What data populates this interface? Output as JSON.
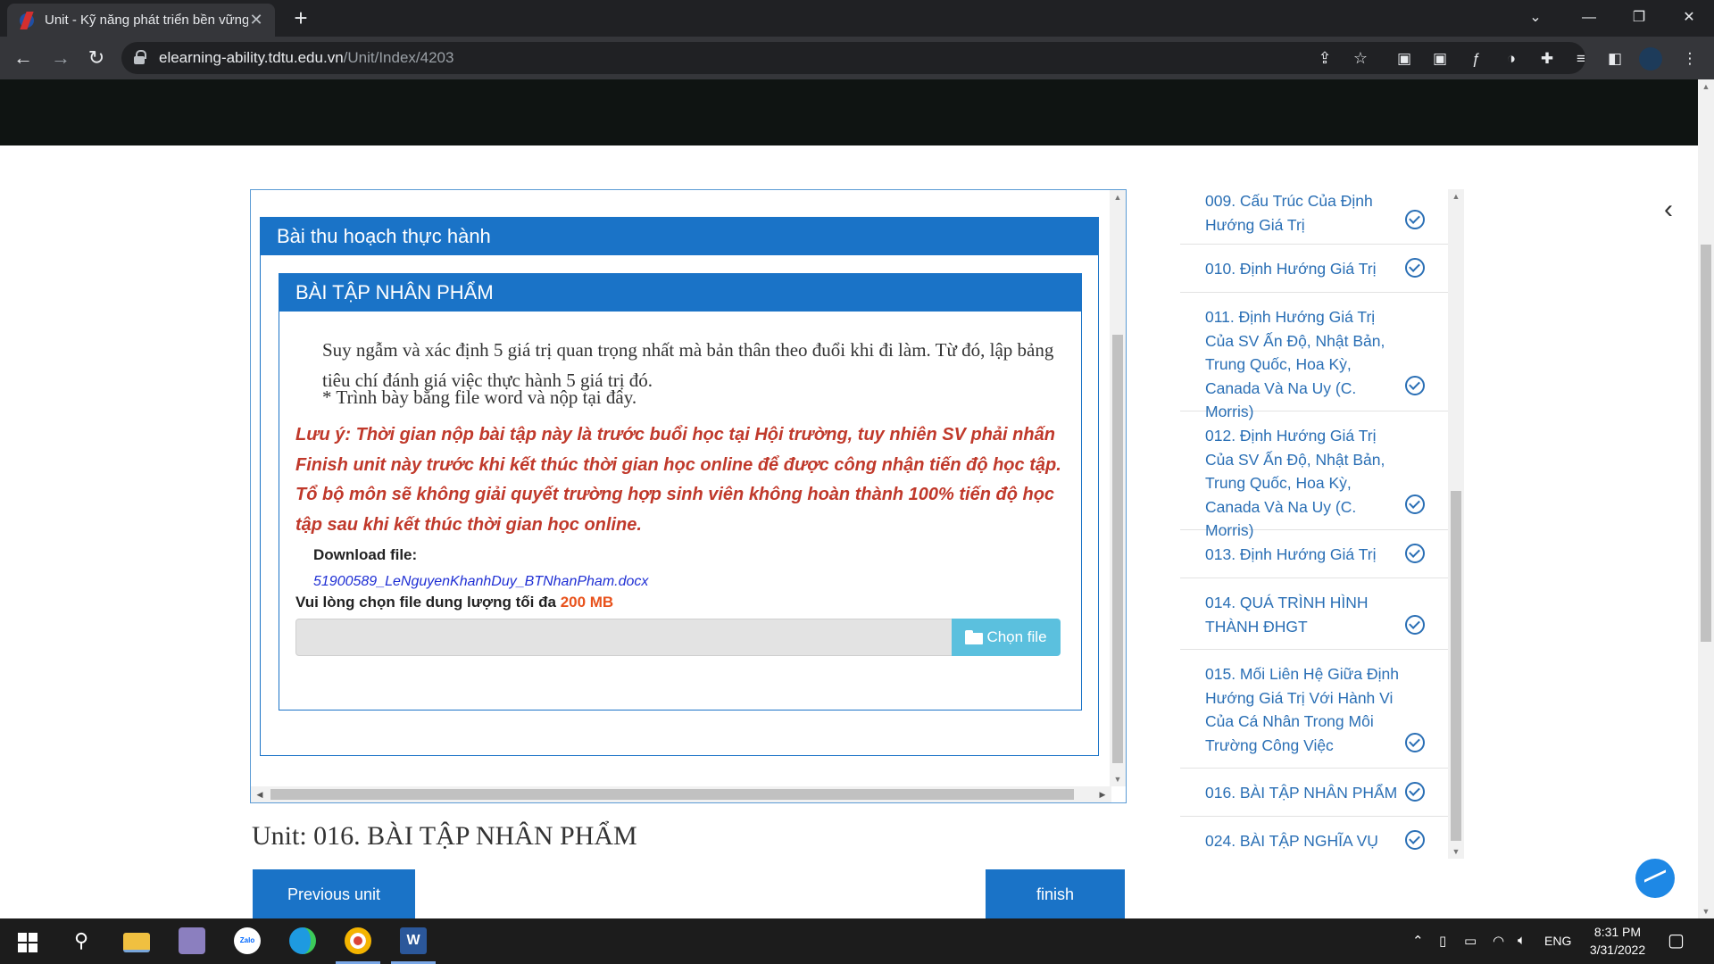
{
  "browser": {
    "tab_title": "Unit - Kỹ năng phát triển bền vững",
    "tab_close": "✕",
    "new_tab": "+",
    "url_host": "elearning-ability.tdtu.edu.vn",
    "url_path": "/Unit/Index/4203",
    "window_controls": [
      "⌄",
      "—",
      "❐",
      "✕"
    ]
  },
  "content": {
    "outer_heading": "Bài thu hoạch thực hành",
    "inner_heading": "BÀI TẬP NHÂN PHẨM",
    "description": "Suy ngẫm và xác định 5 giá trị quan trọng nhất mà bản thân theo đuổi khi đi làm. Từ đó, lập bảng tiêu chí đánh giá việc thực hành 5 giá trị đó.",
    "instruction": "* Trình bày bằng file word và nộp tại đây.",
    "note": "Lưu ý: Thời gian nộp bài tập này là trước buổi học tại Hội trường, tuy nhiên SV phải nhấn Finish unit này trước khi kết thúc thời gian học online để được công nhận tiến độ học tập. Tổ bộ môn sẽ không giải quyết trường hợp sinh viên không hoàn thành 100% tiến độ học tập sau khi kết thúc thời gian học online.",
    "download_label": "Download file:",
    "download_filename": "51900589_LeNguyenKhanhDuy_BTNhanPham.docx",
    "upload_label": "Vui lòng chọn file dung lượng tối đa ",
    "upload_limit": "200 MB",
    "choose_file_label": "Chọn file",
    "accent_color": "#1a73c7",
    "note_color": "#c0392b"
  },
  "unit_title": "Unit: 016. BÀI TẬP NHÂN PHẨM",
  "buttons": {
    "previous": "Previous unit",
    "finish": "finish"
  },
  "unit_list": [
    {
      "label": "009. Cấu Trúc Của Định Hướng Giá Trị",
      "completed": true
    },
    {
      "label": "010. Định Hướng Giá Trị",
      "completed": true
    },
    {
      "label": "011. Định Hướng Giá Trị Của SV Ấn Độ, Nhật Bản, Trung Quốc, Hoa Kỳ, Canada Và Na Uy (C. Morris)",
      "completed": true
    },
    {
      "label": "012. Định Hướng Giá Trị Của SV Ấn Độ, Nhật Bản, Trung Quốc, Hoa Kỳ, Canada Và Na Uy (C. Morris)",
      "completed": true
    },
    {
      "label": "013. Định Hướng Giá Trị",
      "completed": true
    },
    {
      "label": "014. QUÁ TRÌNH HÌNH THÀNH ĐHGT",
      "completed": true
    },
    {
      "label": "015. Mối Liên Hệ Giữa Định Hướng Giá Trị Với Hành Vi Của Cá Nhân Trong Môi Trường Công Việc",
      "completed": true
    },
    {
      "label": "016. BÀI TẬP NHÂN PHẨM",
      "completed": true
    },
    {
      "label": "024. BÀI TẬP NGHĨA VỤ",
      "completed": true
    }
  ],
  "taskbar": {
    "language": "ENG",
    "time": "8:31 PM",
    "date": "3/31/2022",
    "apps": [
      "file-explorer",
      "genshin",
      "zalo",
      "edge",
      "chrome",
      "word"
    ],
    "zalo_label": "Zalo",
    "word_label": "W"
  }
}
